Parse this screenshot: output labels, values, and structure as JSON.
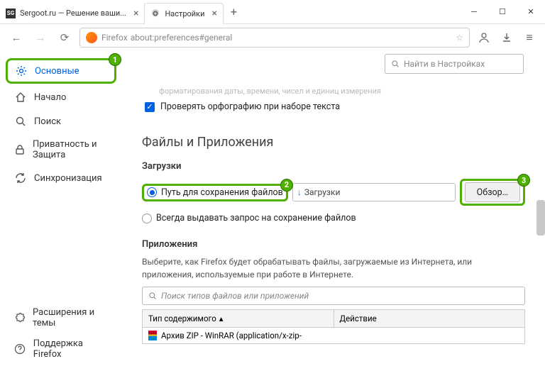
{
  "tabs": [
    {
      "title": "Sergoot.ru — Решение ваши...",
      "favicon": "SG"
    },
    {
      "title": "Настройки",
      "favicon": "gear"
    }
  ],
  "url": {
    "prefix": "Firefox",
    "path": "about:preferences#general"
  },
  "search_settings_placeholder": "Найти в Настройках",
  "sidebar": {
    "items": [
      {
        "label": "Основные",
        "selected": true
      },
      {
        "label": "Начало"
      },
      {
        "label": "Поиск"
      },
      {
        "label": "Приватность и Защита"
      },
      {
        "label": "Синхронизация"
      }
    ],
    "bottom": [
      {
        "label": "Расширения и темы"
      },
      {
        "label": "Поддержка Firefox"
      }
    ]
  },
  "main": {
    "cutoff_text": "...форматирования даты, времени, чисел и единиц измерения",
    "spellcheck": "Проверять орфографию при наборе текста",
    "section_files": "Файлы и Приложения",
    "downloads_heading": "Загрузки",
    "radio_save_path": "Путь для сохранения файлов",
    "download_folder": "Загрузки",
    "browse": "Обзор…",
    "radio_always_ask": "Всегда выдавать запрос на сохранение файлов",
    "apps_heading": "Приложения",
    "apps_desc": "Выберите, как Firefox будет обрабатывать файлы, загружаемые из Интернета, или приложения, используемые при работе в Интернете.",
    "apps_search_placeholder": "Поиск типов файлов или приложений",
    "table": {
      "col1": "Тип содержимого",
      "col2": "Действие",
      "row1": "Архив ZIP - WinRAR (application/x-zip-"
    }
  },
  "badges": {
    "b1": "1",
    "b2": "2",
    "b3": "3"
  }
}
